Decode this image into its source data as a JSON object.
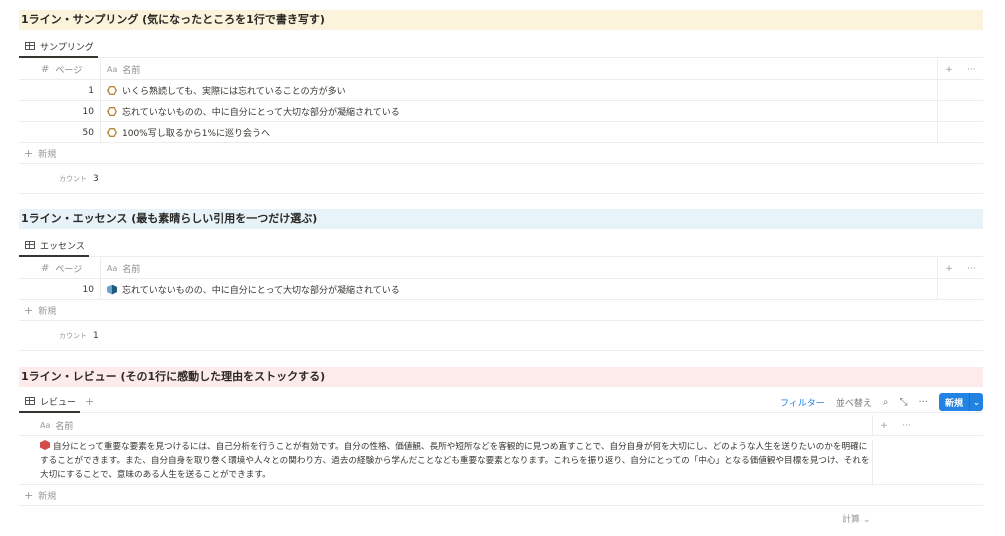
{
  "sections": [
    {
      "heading": "1ライン・サンプリング (気になったところを1行で書き写す)",
      "tab": "サンプリング",
      "header": {
        "page_label": "ページ",
        "name_label": "名前",
        "hash": "#",
        "aa": "Aa"
      },
      "rows": [
        {
          "page": "1",
          "name": "いくら熟読しても、実際には忘れていることの方が多い"
        },
        {
          "page": "10",
          "name": "忘れていないものの、中に自分にとって大切な部分が凝縮されている"
        },
        {
          "page": "50",
          "name": "100%写し取るから1%に巡り会うへ"
        }
      ],
      "new_label": "新規",
      "count_label": "カウント",
      "count": "3"
    },
    {
      "heading": "1ライン・エッセンス (最も素晴らしい引用を一つだけ選ぶ)",
      "tab": "エッセンス",
      "header": {
        "page_label": "ページ",
        "name_label": "名前",
        "hash": "#",
        "aa": "Aa"
      },
      "rows": [
        {
          "page": "10",
          "name": "忘れていないものの、中に自分にとって大切な部分が凝縮されている"
        }
      ],
      "new_label": "新規",
      "count_label": "カウント",
      "count": "1"
    }
  ],
  "review": {
    "heading": "1ライン・レビュー (その1行に感動した理由をストックする)",
    "tab": "レビュー",
    "add_view": "+",
    "toolbar": {
      "filter": "フィルター",
      "sort": "並べ替え",
      "search_glyph": "⌕",
      "expand_glyph": "⤡",
      "more_glyph": "···",
      "new": "新規",
      "chevron": "⌄"
    },
    "header": {
      "name_label": "名前",
      "aa": "Aa"
    },
    "row_text": "自分にとって重要な要素を見つけるには、自己分析を行うことが有効です。自分の性格、価値観、長所や短所などを客観的に見つめ直すことで、自分自身が何を大切にし、どのような人生を送りたいのかを明確にすることができます。また、自分自身を取り巻く環境や人々との関わり方、過去の経験から学んだことなども重要な要素となります。これらを振り返り、自分にとっての「中心」となる価値観や目標を見つけ、それを大切にすることで、意味のある人生を送ることができます。",
    "new_label": "新規",
    "calc": "計算 ⌄"
  },
  "common": {
    "plus": "+",
    "more": "···"
  },
  "colors": {
    "accent": "#2383e2",
    "yellow_bg": "#fbf3db",
    "blue_bg": "#e7f3f8",
    "red_bg": "#fdebec"
  }
}
